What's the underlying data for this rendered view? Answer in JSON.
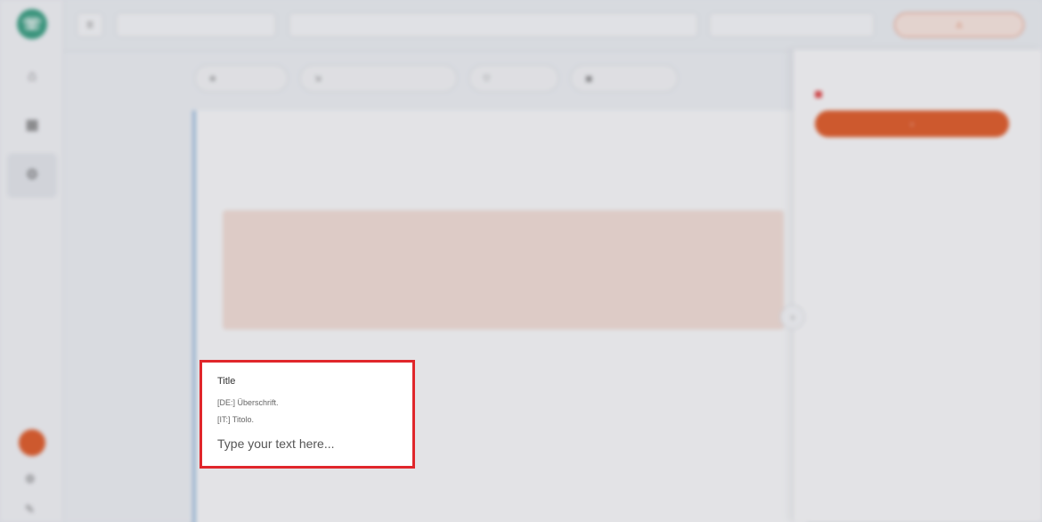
{
  "topbar": {
    "project": "",
    "breadcrumb": [
      "",
      "",
      "",
      ""
    ],
    "selector": "",
    "action": ""
  },
  "toolbar": [
    "",
    "",
    "",
    ""
  ],
  "content": {
    "type_label": "",
    "title": "",
    "guidance_header": "",
    "guidance_de": "",
    "guidance_it": "",
    "next_field_label": ""
  },
  "sidepanel": {
    "workflow_label": "",
    "workflow_value": "",
    "button": "",
    "rows": [
      "",
      "",
      "",
      "",
      "",
      ""
    ]
  },
  "title_field": {
    "label": "Title",
    "hint_de": "[DE:] Überschrift.",
    "hint_it": "[IT:] Titolo.",
    "placeholder": "Type your text here...",
    "value": ""
  },
  "colors": {
    "focus_border": "#e0262b",
    "accent": "#e0521c",
    "brand": "#2f9b7c"
  }
}
